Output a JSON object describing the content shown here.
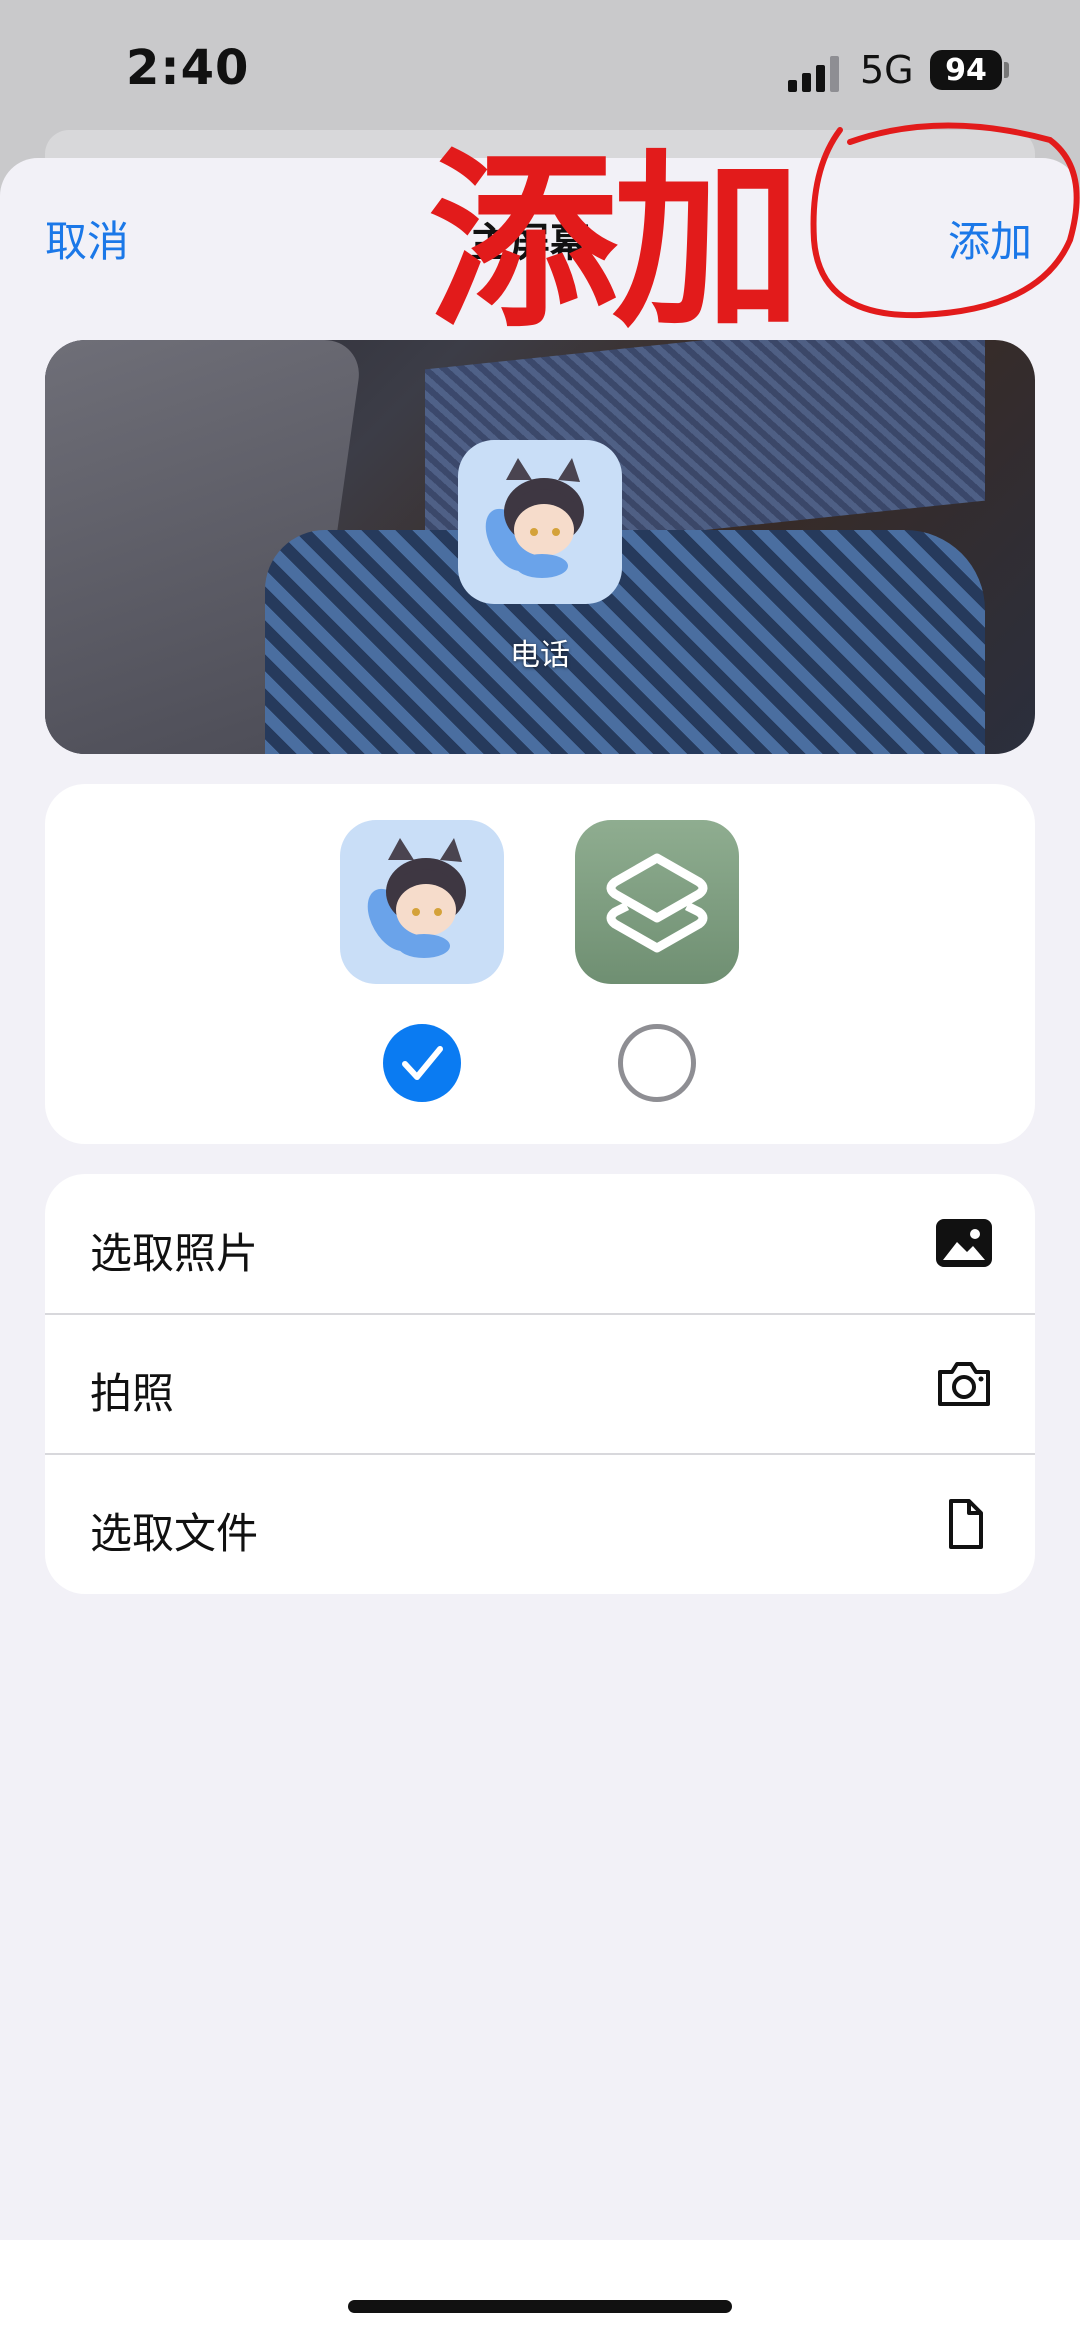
{
  "status": {
    "time": "2:40",
    "network": "5G",
    "battery": "94"
  },
  "nav": {
    "cancel_label": "取消",
    "title": "主屏幕",
    "add_label": "添加"
  },
  "preview": {
    "app_label": "电话"
  },
  "icon_choices": [
    {
      "name": "custom-avatar",
      "selected": true
    },
    {
      "name": "shortcuts-app",
      "selected": false
    }
  ],
  "options": [
    {
      "label": "选取照片",
      "icon": "photo-icon"
    },
    {
      "label": "拍照",
      "icon": "camera-icon"
    },
    {
      "label": "选取文件",
      "icon": "file-icon"
    }
  ],
  "annotation": {
    "text": "添加",
    "color": "#e21b1b"
  },
  "colors": {
    "accent": "#1b78e8",
    "sheet_bg": "#f2f1f7",
    "radio_selected": "#0a7bf2"
  }
}
